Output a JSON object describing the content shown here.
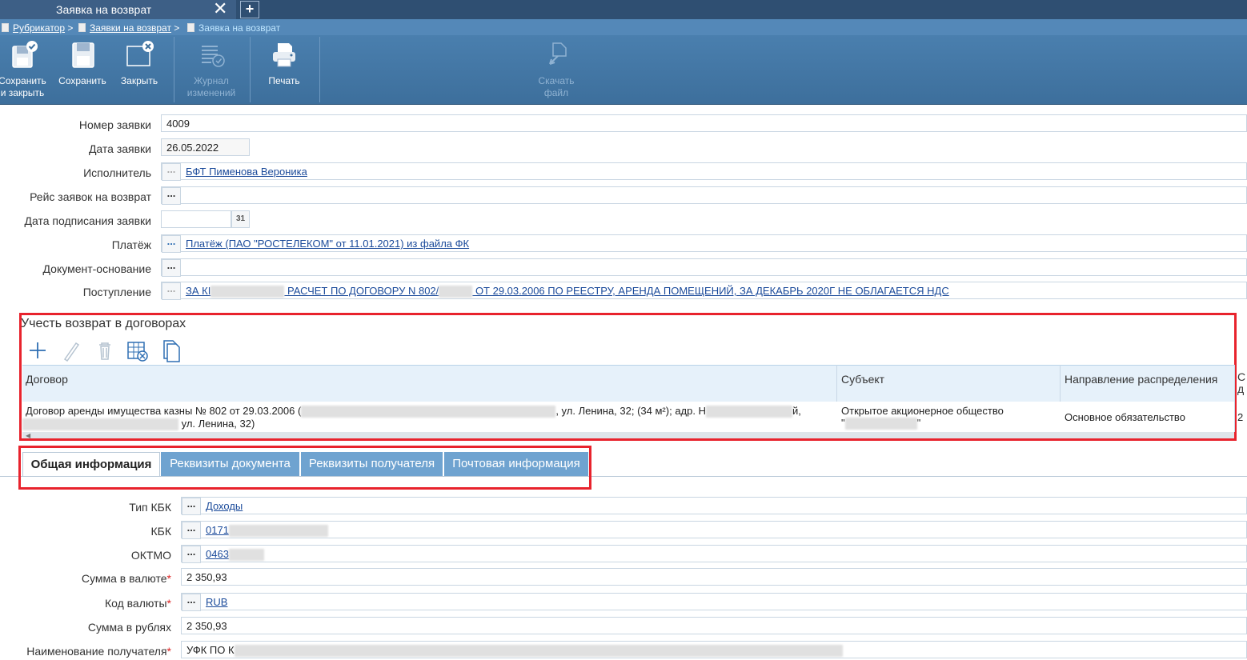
{
  "window": {
    "tab_title": "Заявка на возврат",
    "close_glyph": "✕",
    "new_tab_glyph": "+"
  },
  "breadcrumb": {
    "items": [
      "Рубрикатор",
      "Заявки на возврат"
    ],
    "current": "Заявка на возврат",
    "separator": ">"
  },
  "toolbar": {
    "save_close": [
      "Сохранить",
      "и закрыть"
    ],
    "save": "Сохранить",
    "close": "Закрыть",
    "journal": [
      "Журнал",
      "изменений"
    ],
    "print": "Печать",
    "download": [
      "Скачать",
      "файл"
    ]
  },
  "form": {
    "number_label": "Номер заявки",
    "number_value": "4009",
    "date_label": "Дата заявки",
    "date_value": "26.05.2022",
    "executor_label": "Исполнитель",
    "executor_value": "БФТ Пименова Вероника",
    "trip_label": "Рейс заявок на возврат",
    "sign_date_label": "Дата подписания заявки",
    "calendar_glyph": "31",
    "payment_label": "Платёж",
    "payment_value": "Платёж (ПАО \"РОСТЕЛЕКОМ\" от 11.01.2021) из файла ФК",
    "basis_label": "Документ-основание",
    "receipt_label": "Поступление",
    "receipt_value_a": "ЗА КІ",
    "receipt_value_b": "РАСЧЕТ ПО ДОГОВОРУ N 802/",
    "receipt_value_c": "ОТ 29.03.2006 ПО РЕЕСТРУ, АРЕНДА ПОМЕЩЕНИЙ, ЗА ДЕКАБРЬ 2020Г НЕ ОБЛАГАЕТСЯ НДС",
    "dots": "..."
  },
  "contracts": {
    "title": "Учесть возврат в договорах",
    "columns": [
      "Договор",
      "Субъект",
      "Направление распределения",
      "С",
      "д"
    ],
    "row": {
      "contract_a": "Договор аренды имущества казны № 802 от 29.03.2006 (",
      "contract_b": ", ул. Ленина, 32; (34 м²); адр. Н",
      "contract_c": "й,",
      "contract_d": "ул. Ленина, 32)",
      "subject_a": "Открытое акционерное общество",
      "subject_b": "\"",
      "subject_c": "\"",
      "direction": "Основное обязательство",
      "extra": "2"
    },
    "scroll_arrow": "◀"
  },
  "subtabs": [
    "Общая информация",
    "Реквизиты документа",
    "Реквизиты получателя",
    "Почтовая информация"
  ],
  "general": {
    "kbk_type_label": "Тип КБК",
    "kbk_type_value": "Доходы",
    "kbk_label": "КБК",
    "kbk_value": "0171",
    "oktmo_label": "ОКТМО",
    "oktmo_value": "0463",
    "sum_currency_label": "Сумма в валюте",
    "sum_currency_value": "2 350,93",
    "currency_code_label": "Код валюты",
    "currency_code_value": "RUB",
    "sum_rub_label": "Сумма в рублях",
    "sum_rub_value": "2 350,93",
    "recipient_label": "Наименование получателя",
    "recipient_value": "УФК ПО К",
    "required_mark": "*"
  }
}
